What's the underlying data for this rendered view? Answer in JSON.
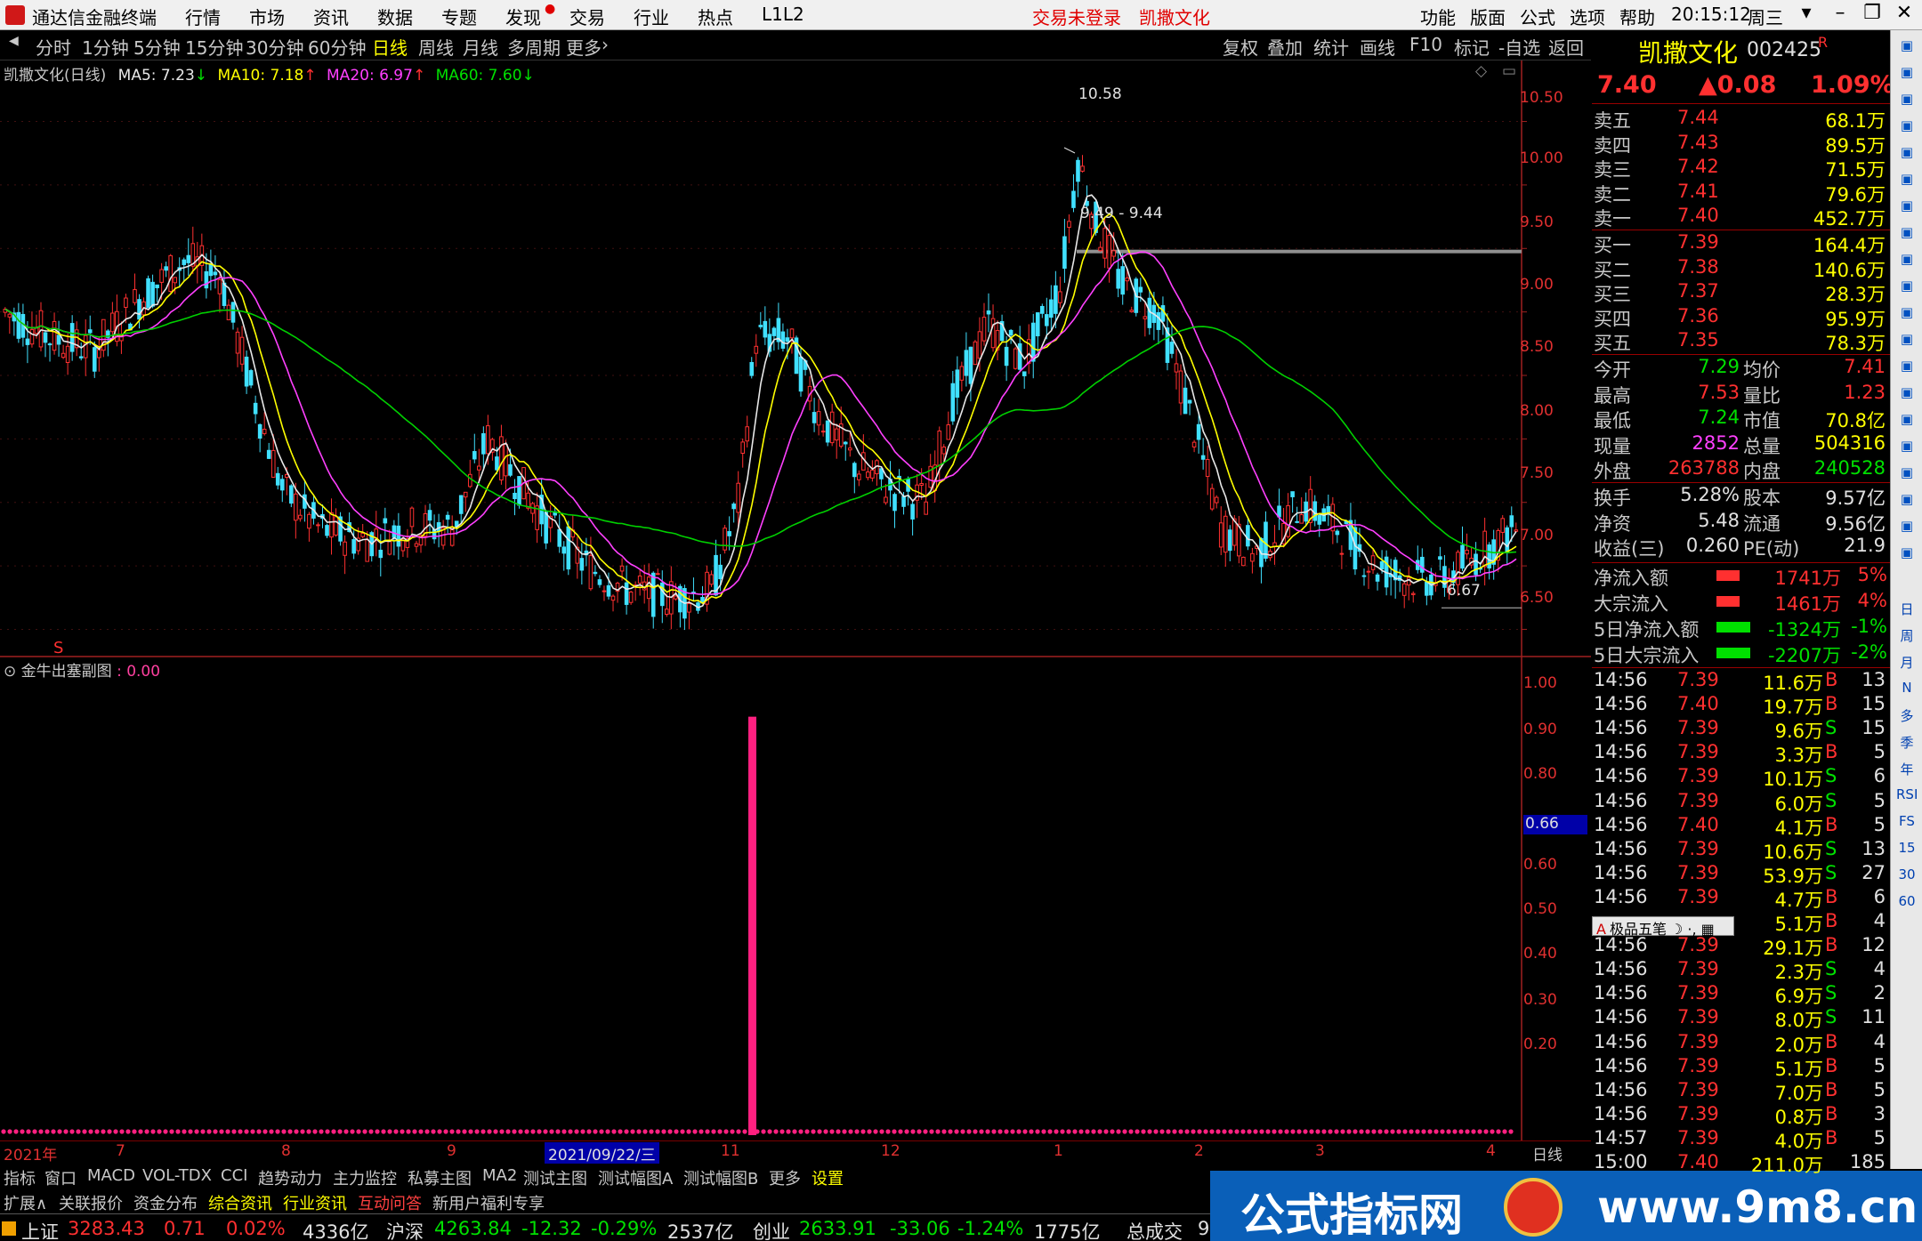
{
  "app": {
    "title": "通达信金融终端"
  },
  "top_menu": {
    "items": [
      "行情",
      "市场",
      "资讯",
      "数据",
      "专题",
      "发现",
      "交易",
      "行业",
      "热点",
      "L1L2"
    ],
    "login": "交易未登录",
    "stock": "凯撒文化",
    "right_items": [
      "功能",
      "版面",
      "公式",
      "选项",
      "帮助"
    ],
    "time": "20:15:12",
    "weekday": "周三"
  },
  "periods": [
    "分时",
    "1分钟",
    "5分钟",
    "15分钟",
    "30分钟",
    "60分钟",
    "日线",
    "周线",
    "月线",
    "多周期",
    "更多"
  ],
  "toolbar": [
    "复权",
    "叠加",
    "统计",
    "画线",
    "F10",
    "标记",
    "-自选",
    "返回"
  ],
  "ma_line": {
    "name": "凯撒文化(日线)",
    "ma5": "MA5: 7.23",
    "ma10": "MA10: 7.18",
    "ma20": "MA20: 6.97",
    "ma60": "MA60: 7.60"
  },
  "price_axis": [
    "10.50",
    "10.00",
    "9.50",
    "9.00",
    "8.50",
    "8.00",
    "7.50",
    "7.00",
    "6.50"
  ],
  "annotations": {
    "high": "10.58",
    "band": "9.49 - 9.44",
    "low": "6.67"
  },
  "sub_chart": {
    "title": "金牛出塞副图",
    "value": "0.00",
    "axis": [
      "1.00",
      "0.90",
      "0.80",
      "0.66",
      "0.60",
      "0.50",
      "0.40",
      "0.30",
      "0.20"
    ]
  },
  "dates": [
    "2021年",
    "7",
    "8",
    "9",
    "2021/09/22/三",
    "11",
    "12",
    "1",
    "2",
    "3",
    "4"
  ],
  "date_right": "日线",
  "tabs": [
    "指标",
    "窗口",
    "MACD",
    "VOL-TDX",
    "CCI",
    "趋势动力",
    "主力监控",
    "私募主图",
    "MA2",
    "测试主图",
    "测试幅图A",
    "测试幅图B",
    "更多",
    "设置"
  ],
  "tabs2": [
    "扩展∧",
    "关联报价",
    "资金分布",
    "综合资讯",
    "行业资讯",
    "互动问答",
    "新用户福利专享"
  ],
  "status": {
    "sh_label": "上证",
    "sh": "3283.43",
    "sh_chg": "0.71",
    "sh_pct": "0.02%",
    "sh_amt": "4336亿",
    "hs_label": "沪深",
    "hs": "4263.84",
    "hs_chg": "-12.32",
    "hs_pct": "-0.29%",
    "hs_amt": "2537亿",
    "cy_label": "创业",
    "cy": "2633.91",
    "cy_chg": "-33.06",
    "cy_pct": "-1.24%",
    "cy_amt": "1775亿",
    "total_label": "总成交",
    "total": "9"
  },
  "banner": {
    "left": "公式指标网",
    "right": "www.9m8.cn"
  },
  "quote": {
    "name": "凯撒文化",
    "code": "002425",
    "flag": "R",
    "price": "7.40",
    "change": "▲0.08",
    "pct": "1.09%",
    "asks": [
      {
        "l": "卖五",
        "p": "7.44",
        "v": "68.1万"
      },
      {
        "l": "卖四",
        "p": "7.43",
        "v": "89.5万"
      },
      {
        "l": "卖三",
        "p": "7.42",
        "v": "71.5万"
      },
      {
        "l": "卖二",
        "p": "7.41",
        "v": "79.6万"
      },
      {
        "l": "卖一",
        "p": "7.40",
        "v": "452.7万"
      }
    ],
    "bids": [
      {
        "l": "买一",
        "p": "7.39",
        "v": "164.4万"
      },
      {
        "l": "买二",
        "p": "7.38",
        "v": "140.6万"
      },
      {
        "l": "买三",
        "p": "7.37",
        "v": "28.3万"
      },
      {
        "l": "买四",
        "p": "7.36",
        "v": "95.9万"
      },
      {
        "l": "买五",
        "p": "7.35",
        "v": "78.3万"
      }
    ],
    "stats": [
      {
        "a": "今开",
        "b": "7.29",
        "c": "均价",
        "d": "7.41"
      },
      {
        "a": "最高",
        "b": "7.53",
        "c": "量比",
        "d": "1.23"
      },
      {
        "a": "最低",
        "b": "7.24",
        "c": "市值",
        "d": "70.8亿"
      },
      {
        "a": "现量",
        "b": "2852",
        "c": "总量",
        "d": "504316"
      },
      {
        "a": "外盘",
        "b": "263788",
        "c": "内盘",
        "d": "240528"
      }
    ],
    "stats2": [
      {
        "a": "换手",
        "b": "5.28%",
        "c": "股本",
        "d": "9.57亿"
      },
      {
        "a": "净资",
        "b": "5.48",
        "c": "流通",
        "d": "9.56亿"
      },
      {
        "a": "收益(三)",
        "b": "0.260",
        "c": "PE(动)",
        "d": "21.9"
      }
    ],
    "flows": [
      {
        "a": "净流入额",
        "v": "1741万",
        "p": "5%",
        "pos": true
      },
      {
        "a": "大宗流入",
        "v": "1461万",
        "p": "4%",
        "pos": true
      },
      {
        "a": "5日净流入额",
        "v": "-1324万",
        "p": "-1%",
        "pos": false
      },
      {
        "a": "5日大宗流入",
        "v": "-2207万",
        "p": "-2%",
        "pos": false
      }
    ],
    "ticks": [
      {
        "t": "14:56",
        "p": "7.39",
        "v": "11.6万",
        "s": "B",
        "n": "13"
      },
      {
        "t": "14:56",
        "p": "7.40",
        "v": "19.7万",
        "s": "B",
        "n": "15"
      },
      {
        "t": "14:56",
        "p": "7.39",
        "v": "9.6万",
        "s": "S",
        "n": "15"
      },
      {
        "t": "14:56",
        "p": "7.39",
        "v": "3.3万",
        "s": "B",
        "n": "5"
      },
      {
        "t": "14:56",
        "p": "7.39",
        "v": "10.1万",
        "s": "S",
        "n": "6"
      },
      {
        "t": "14:56",
        "p": "7.39",
        "v": "6.0万",
        "s": "S",
        "n": "5"
      },
      {
        "t": "14:56",
        "p": "7.40",
        "v": "4.1万",
        "s": "B",
        "n": "5"
      },
      {
        "t": "14:56",
        "p": "7.39",
        "v": "10.6万",
        "s": "S",
        "n": "13"
      },
      {
        "t": "14:56",
        "p": "7.39",
        "v": "53.9万",
        "s": "S",
        "n": "27"
      },
      {
        "t": "14:56",
        "p": "7.39",
        "v": "4.7万",
        "s": "B",
        "n": "6"
      },
      {
        "t": "",
        "p": "",
        "v": "5.1万",
        "s": "B",
        "n": "4"
      },
      {
        "t": "14:56",
        "p": "7.39",
        "v": "29.1万",
        "s": "B",
        "n": "12"
      },
      {
        "t": "14:56",
        "p": "7.39",
        "v": "2.3万",
        "s": "S",
        "n": "4"
      },
      {
        "t": "14:56",
        "p": "7.39",
        "v": "6.9万",
        "s": "S",
        "n": "2"
      },
      {
        "t": "14:56",
        "p": "7.39",
        "v": "8.0万",
        "s": "S",
        "n": "11"
      },
      {
        "t": "14:56",
        "p": "7.39",
        "v": "2.0万",
        "s": "B",
        "n": "4"
      },
      {
        "t": "14:56",
        "p": "7.39",
        "v": "5.1万",
        "s": "B",
        "n": "5"
      },
      {
        "t": "14:56",
        "p": "7.39",
        "v": "7.0万",
        "s": "B",
        "n": "5"
      },
      {
        "t": "14:56",
        "p": "7.39",
        "v": "0.8万",
        "s": "B",
        "n": "3"
      },
      {
        "t": "14:57",
        "p": "7.39",
        "v": "4.0万",
        "s": "B",
        "n": "5"
      },
      {
        "t": "15:00",
        "p": "7.40",
        "v": "211.0万",
        "s": "",
        "n": "185"
      }
    ],
    "five_label": "极品五笔"
  },
  "strip": [
    "日",
    "周",
    "月",
    "N",
    "多",
    "季",
    "年",
    "RSI",
    "FS",
    "15",
    "30",
    "60"
  ]
}
